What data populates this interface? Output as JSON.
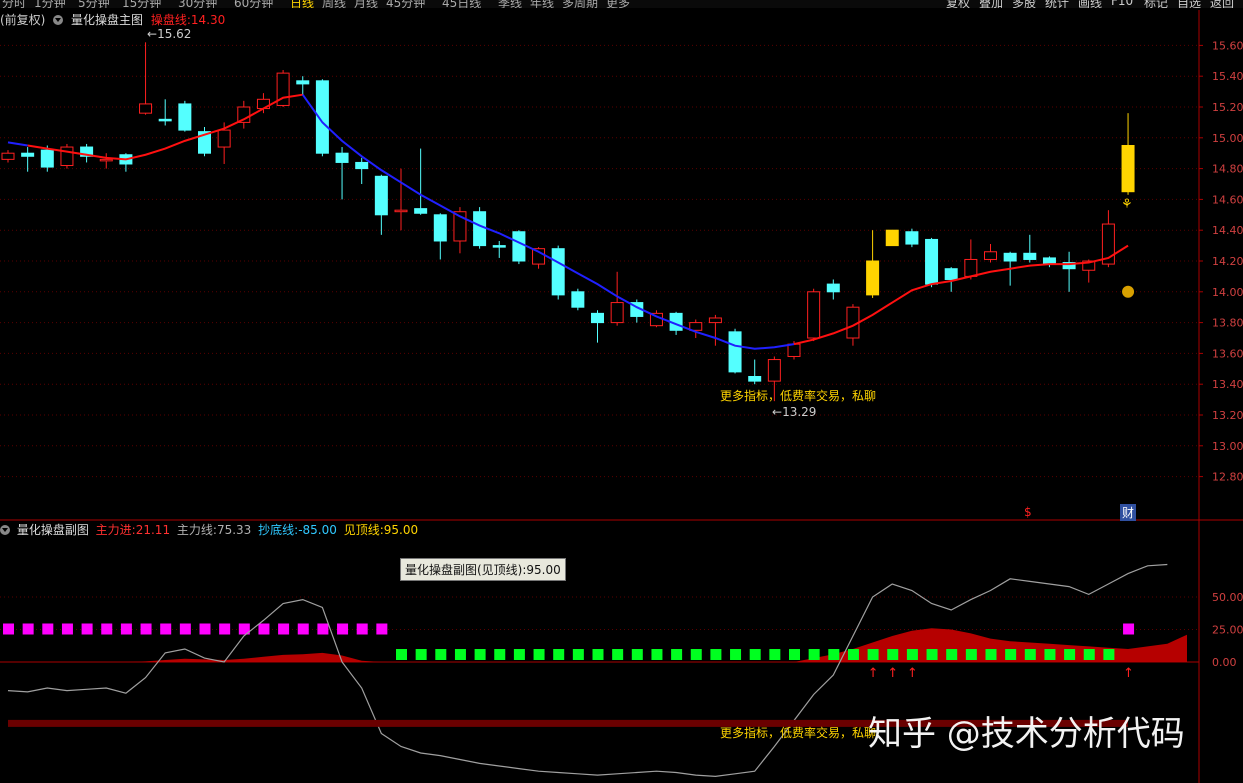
{
  "toolbar": {
    "periods": [
      "分时",
      "1分钟",
      "5分钟",
      "15分钟",
      "30分钟",
      "60分钟",
      "日线",
      "周线",
      "月线",
      "45分钟",
      "45日线",
      "季线",
      "年线",
      "多周期",
      "更多"
    ],
    "active_period": "日线",
    "right_buttons": [
      "复权",
      "叠加",
      "多股",
      "统计",
      "画线",
      "F10",
      "标记",
      "自选",
      "返回"
    ]
  },
  "main_panel": {
    "adjust_label": "(前复权)",
    "indicator_name": "量化操盘主图",
    "line_label": "操盘线:",
    "line_value": "14.30",
    "high_marker": "15.62",
    "low_marker": "13.29",
    "ad_text": "更多指标，低费率交易，私聊",
    "bottom_markers": [
      "$",
      "财"
    ]
  },
  "sub_panel": {
    "indicator_name": "量化操盘副图",
    "items": [
      {
        "label": "主力进:",
        "value": "21.11",
        "color": "#ff3030"
      },
      {
        "label": "主力线:",
        "value": "75.33",
        "color": "#b0b0b0"
      },
      {
        "label": "抄底线:",
        "value": "-85.00",
        "color": "#30c8ff"
      },
      {
        "label": "见顶线:",
        "value": "95.00",
        "color": "#ffd400"
      }
    ],
    "tooltip": "量化操盘副图(见顶线):95.00",
    "ad_text": "更多指标，低费率交易，私聊"
  },
  "watermark": "知乎 @技术分析代码",
  "colors": {
    "up": "#ff2020",
    "down": "#54ffff",
    "special": "#ffd400",
    "ma_red": "#ff1010",
    "ma_blue": "#2020ff",
    "grid": "#5a0000",
    "magenta": "#ff00ff",
    "green": "#00ff20"
  },
  "chart_data": [
    {
      "type": "candlestick",
      "title": "量化操盘主图",
      "ylim": [
        12.7,
        15.7
      ],
      "y_ticks": [
        12.8,
        13.0,
        13.2,
        13.4,
        13.6,
        13.8,
        14.0,
        14.2,
        14.4,
        14.6,
        14.8,
        15.0,
        15.2,
        15.4,
        15.6
      ],
      "candles": [
        {
          "o": 14.86,
          "c": 14.9,
          "h": 14.92,
          "l": 14.84
        },
        {
          "o": 14.9,
          "c": 14.88,
          "h": 14.94,
          "l": 14.78
        },
        {
          "o": 14.92,
          "c": 14.81,
          "h": 14.95,
          "l": 14.78
        },
        {
          "o": 14.82,
          "c": 14.94,
          "h": 14.96,
          "l": 14.8
        },
        {
          "o": 14.94,
          "c": 14.88,
          "h": 14.96,
          "l": 14.84
        },
        {
          "o": 14.86,
          "c": 14.86,
          "h": 14.9,
          "l": 14.8
        },
        {
          "o": 14.89,
          "c": 14.83,
          "h": 14.9,
          "l": 14.78
        },
        {
          "o": 15.16,
          "c": 15.22,
          "h": 15.62,
          "l": 15.15
        },
        {
          "o": 15.12,
          "c": 15.11,
          "h": 15.25,
          "l": 15.08
        },
        {
          "o": 15.22,
          "c": 15.05,
          "h": 15.24,
          "l": 15.04
        },
        {
          "o": 15.04,
          "c": 14.9,
          "h": 15.07,
          "l": 14.88
        },
        {
          "o": 14.94,
          "c": 15.05,
          "h": 15.1,
          "l": 14.83
        },
        {
          "o": 15.1,
          "c": 15.2,
          "h": 15.24,
          "l": 15.06
        },
        {
          "o": 15.19,
          "c": 15.25,
          "h": 15.29,
          "l": 15.16
        },
        {
          "o": 15.21,
          "c": 15.42,
          "h": 15.44,
          "l": 15.2
        },
        {
          "o": 15.37,
          "c": 15.35,
          "h": 15.4,
          "l": 15.28
        },
        {
          "o": 15.37,
          "c": 14.9,
          "h": 15.38,
          "l": 14.88
        },
        {
          "o": 14.9,
          "c": 14.84,
          "h": 14.94,
          "l": 14.6
        },
        {
          "o": 14.84,
          "c": 14.8,
          "h": 14.87,
          "l": 14.7
        },
        {
          "o": 14.75,
          "c": 14.5,
          "h": 14.76,
          "l": 14.37
        },
        {
          "o": 14.53,
          "c": 14.53,
          "h": 14.8,
          "l": 14.4
        },
        {
          "o": 14.54,
          "c": 14.51,
          "h": 14.93,
          "l": 14.5
        },
        {
          "o": 14.5,
          "c": 14.33,
          "h": 14.51,
          "l": 14.21
        },
        {
          "o": 14.33,
          "c": 14.52,
          "h": 14.55,
          "l": 14.25
        },
        {
          "o": 14.52,
          "c": 14.3,
          "h": 14.55,
          "l": 14.28
        },
        {
          "o": 14.3,
          "c": 14.29,
          "h": 14.33,
          "l": 14.22
        },
        {
          "o": 14.39,
          "c": 14.2,
          "h": 14.4,
          "l": 14.18
        },
        {
          "o": 14.18,
          "c": 14.28,
          "h": 14.29,
          "l": 14.15
        },
        {
          "o": 14.28,
          "c": 13.98,
          "h": 14.3,
          "l": 13.95
        },
        {
          "o": 14.0,
          "c": 13.9,
          "h": 14.02,
          "l": 13.88
        },
        {
          "o": 13.86,
          "c": 13.8,
          "h": 13.88,
          "l": 13.67
        },
        {
          "o": 13.8,
          "c": 13.93,
          "h": 14.13,
          "l": 13.78
        },
        {
          "o": 13.93,
          "c": 13.84,
          "h": 13.95,
          "l": 13.8
        },
        {
          "o": 13.78,
          "c": 13.86,
          "h": 13.88,
          "l": 13.77
        },
        {
          "o": 13.86,
          "c": 13.75,
          "h": 13.87,
          "l": 13.72
        },
        {
          "o": 13.75,
          "c": 13.8,
          "h": 13.82,
          "l": 13.7
        },
        {
          "o": 13.8,
          "c": 13.83,
          "h": 13.85,
          "l": 13.65
        },
        {
          "o": 13.74,
          "c": 13.48,
          "h": 13.76,
          "l": 13.47
        },
        {
          "o": 13.45,
          "c": 13.42,
          "h": 13.56,
          "l": 13.4
        },
        {
          "o": 13.42,
          "c": 13.56,
          "h": 13.58,
          "l": 13.29
        },
        {
          "o": 13.58,
          "c": 13.66,
          "h": 13.68,
          "l": 13.56
        },
        {
          "o": 13.7,
          "c": 14.0,
          "h": 14.02,
          "l": 13.68
        },
        {
          "o": 14.05,
          "c": 14.0,
          "h": 14.08,
          "l": 13.95
        },
        {
          "o": 13.7,
          "c": 13.9,
          "h": 13.92,
          "l": 13.65
        },
        {
          "o": 13.98,
          "c": 14.2,
          "h": 14.4,
          "l": 13.96,
          "special": true
        },
        {
          "o": 14.4,
          "c": 14.3,
          "h": 14.4,
          "l": 14.3,
          "special": true
        },
        {
          "o": 14.39,
          "c": 14.31,
          "h": 14.41,
          "l": 14.29
        },
        {
          "o": 14.34,
          "c": 14.05,
          "h": 14.35,
          "l": 14.03
        },
        {
          "o": 14.15,
          "c": 14.08,
          "h": 14.16,
          "l": 14.0
        },
        {
          "o": 14.1,
          "c": 14.21,
          "h": 14.34,
          "l": 14.08
        },
        {
          "o": 14.21,
          "c": 14.26,
          "h": 14.31,
          "l": 14.19
        },
        {
          "o": 14.25,
          "c": 14.2,
          "h": 14.26,
          "l": 14.04
        },
        {
          "o": 14.25,
          "c": 14.21,
          "h": 14.37,
          "l": 14.19
        },
        {
          "o": 14.22,
          "c": 14.18,
          "h": 14.23,
          "l": 14.16
        },
        {
          "o": 14.19,
          "c": 14.15,
          "h": 14.26,
          "l": 14.0
        },
        {
          "o": 14.14,
          "c": 14.2,
          "h": 14.21,
          "l": 14.06
        },
        {
          "o": 14.18,
          "c": 14.44,
          "h": 14.53,
          "l": 14.16
        },
        {
          "o": 14.65,
          "c": 14.95,
          "h": 15.16,
          "l": 14.63,
          "special": true
        }
      ],
      "ma_line": [
        14.97,
        14.95,
        14.93,
        14.91,
        14.89,
        14.87,
        14.86,
        14.89,
        14.93,
        14.98,
        15.02,
        15.06,
        15.12,
        15.19,
        15.26,
        15.28,
        15.1,
        14.98,
        14.88,
        14.79,
        14.71,
        14.63,
        14.56,
        14.49,
        14.43,
        14.38,
        14.32,
        14.26,
        14.19,
        14.12,
        14.05,
        13.97,
        13.9,
        13.84,
        13.79,
        13.74,
        13.7,
        13.65,
        13.63,
        13.64,
        13.66,
        13.69,
        13.73,
        13.78,
        13.85,
        13.93,
        14.01,
        14.05,
        14.07,
        14.1,
        14.13,
        14.15,
        14.17,
        14.18,
        14.18,
        14.19,
        14.22,
        14.3
      ],
      "ma_color_switch_index": 16
    },
    {
      "type": "indicator",
      "title": "量化操盘副图",
      "ylim": [
        -100,
        100
      ],
      "y_ticks": [
        50.0,
        25.0,
        0.0
      ],
      "signal": [
        "up",
        "up",
        "up",
        "up",
        "up",
        "up",
        "up",
        "up",
        "up",
        "up",
        "up",
        "up",
        "up",
        "up",
        "up",
        "up",
        "up",
        "up",
        "up",
        "up",
        "down",
        "down",
        "down",
        "down",
        "down",
        "down",
        "down",
        "down",
        "down",
        "down",
        "down",
        "down",
        "down",
        "down",
        "down",
        "down",
        "down",
        "down",
        "down",
        "down",
        "down",
        "down",
        "down",
        "down",
        "down",
        "down",
        "down",
        "down",
        "down",
        "down",
        "down",
        "down",
        "down",
        "down",
        "down",
        "down",
        "down",
        "up"
      ],
      "main_force": [
        0,
        0,
        0,
        0,
        0,
        0,
        0,
        0.5,
        1.5,
        2.5,
        2.0,
        1.5,
        2.5,
        4.0,
        5.5,
        6.0,
        7.0,
        5.0,
        1.0,
        0,
        0,
        0,
        0,
        0,
        0,
        0,
        0,
        0,
        0,
        0,
        0,
        0,
        0,
        0,
        0,
        0,
        0,
        0,
        0,
        0,
        0,
        3,
        6,
        10,
        15,
        20,
        24,
        26,
        25,
        22,
        18,
        16,
        15,
        14,
        13,
        12,
        11,
        10,
        12,
        14,
        21
      ],
      "main_line": [
        -22,
        -23,
        -20,
        -22,
        -21,
        -20,
        -24,
        -12,
        7,
        10,
        3,
        0,
        20,
        32,
        45,
        48,
        42,
        0,
        -20,
        -55,
        -65,
        -70,
        -72,
        -75,
        -78,
        -80,
        -82,
        -84,
        -85,
        -86,
        -87,
        -86,
        -85,
        -84,
        -85,
        -87,
        -88,
        -86,
        -84,
        -65,
        -45,
        -25,
        -10,
        20,
        50,
        60,
        55,
        45,
        40,
        48,
        55,
        64,
        62,
        60,
        58,
        52,
        60,
        68,
        74,
        75
      ],
      "bottom_line": -85.0,
      "top_line": 95.0,
      "arrows_at": [
        44,
        45,
        46,
        57
      ]
    }
  ]
}
